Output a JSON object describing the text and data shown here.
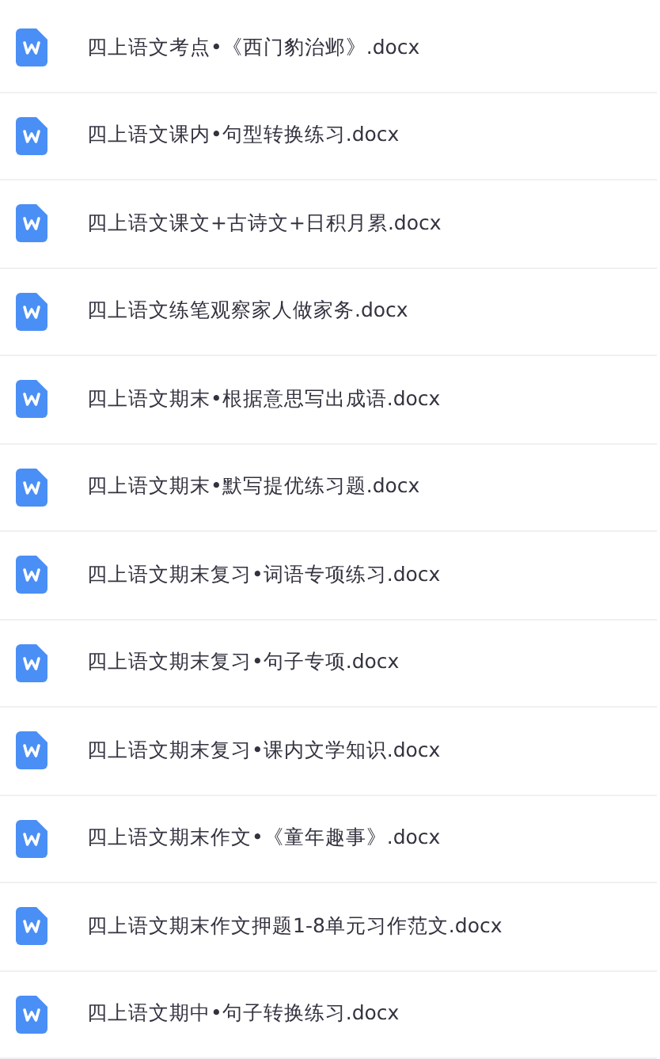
{
  "files": [
    {
      "name": "四上语文考点•《西门豹治邺》.docx"
    },
    {
      "name": "四上语文课内•句型转换练习.docx"
    },
    {
      "name": "四上语文课文+古诗文+日积月累.docx"
    },
    {
      "name": "四上语文练笔观察家人做家务.docx"
    },
    {
      "name": "四上语文期末•根据意思写出成语.docx"
    },
    {
      "name": "四上语文期末•默写提优练习题.docx"
    },
    {
      "name": "四上语文期末复习•词语专项练习.docx"
    },
    {
      "name": "四上语文期末复习•句子专项.docx"
    },
    {
      "name": "四上语文期末复习•课内文学知识.docx"
    },
    {
      "name": "四上语文期末作文•《童年趣事》.docx"
    },
    {
      "name": "四上语文期末作文押题1-8单元习作范文.docx"
    },
    {
      "name": "四上语文期中•句子转换练习.docx"
    }
  ]
}
